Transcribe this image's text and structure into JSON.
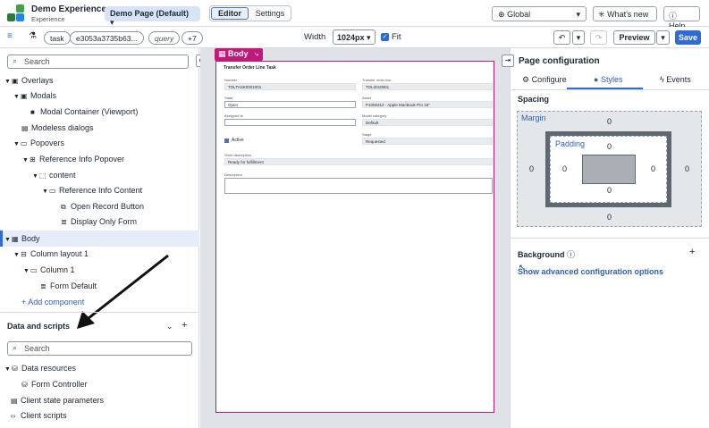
{
  "header": {
    "app_title": "Demo Experience",
    "app_subtitle": "Experience",
    "page_select": "Demo Page (Default)",
    "tab_editor": "Editor",
    "tab_settings": "Settings",
    "scope": "Global",
    "whats_new": "What's new",
    "help": "Help"
  },
  "toolbar": {
    "chip_task": "task",
    "chip_id": "e3053a3735b63...",
    "chip_query": "query",
    "chip_more": "+7",
    "width_label": "Width",
    "width_value": "1024px",
    "fit_label": "Fit",
    "preview": "Preview",
    "save": "Save"
  },
  "left": {
    "search_placeholder": "Search",
    "tree": {
      "overlays": "Overlays",
      "modals": "Modals",
      "modal_container": "Modal Container (Viewport)",
      "modeless": "Modeless dialogs",
      "popovers": "Popovers",
      "ref_popover": "Reference Info Popover",
      "content": "content",
      "ref_content": "Reference Info Content",
      "open_record": "Open Record Button",
      "display_only": "Display Only Form",
      "body": "Body",
      "column_layout": "Column layout 1",
      "column": "Column 1",
      "form_default": "Form Default",
      "add_component": "+ Add component"
    },
    "data_scripts_title": "Data and scripts",
    "data_search_placeholder": "Search",
    "data_tree": {
      "data_resources": "Data resources",
      "form_controller": "Form Controller",
      "client_state": "Client state parameters",
      "client_scripts": "Client scripts"
    }
  },
  "canvas": {
    "body_tag": "Body",
    "form": {
      "title": "Transfer Order Line Task",
      "number_label": "Number",
      "number_value": "TOLTASK0001001",
      "tol_label": "Transfer order line",
      "tol_value": "TOL0010001",
      "state_label": "State",
      "state_value": "Open",
      "asset_label": "Asset",
      "asset_value": "P1000312 - Apple MacBook Pro 15\"",
      "assigned_label": "Assigned to",
      "assigned_value": "",
      "model_cat_label": "Model category",
      "model_cat_value": "Default",
      "active_label": "Active",
      "stage_label": "Stage",
      "stage_value": "Requested",
      "short_desc_label": "Short description",
      "short_desc_value": "Ready for fulfillment",
      "desc_label": "Description",
      "desc_value": ""
    }
  },
  "right": {
    "title": "Page configuration",
    "tab_configure": "Configure",
    "tab_styles": "Styles",
    "tab_events": "Events",
    "spacing_title": "Spacing",
    "margin_label": "Margin",
    "padding_label": "Padding",
    "margin": {
      "top": "0",
      "right": "0",
      "bottom": "0",
      "left": "0"
    },
    "padding": {
      "top": "0",
      "right": "0",
      "bottom": "0",
      "left": "0"
    },
    "background_title": "Background",
    "advanced_link": "Show advanced configuration options"
  },
  "colors": {
    "accent": "#2f6bd6",
    "selection": "#c2187a"
  }
}
